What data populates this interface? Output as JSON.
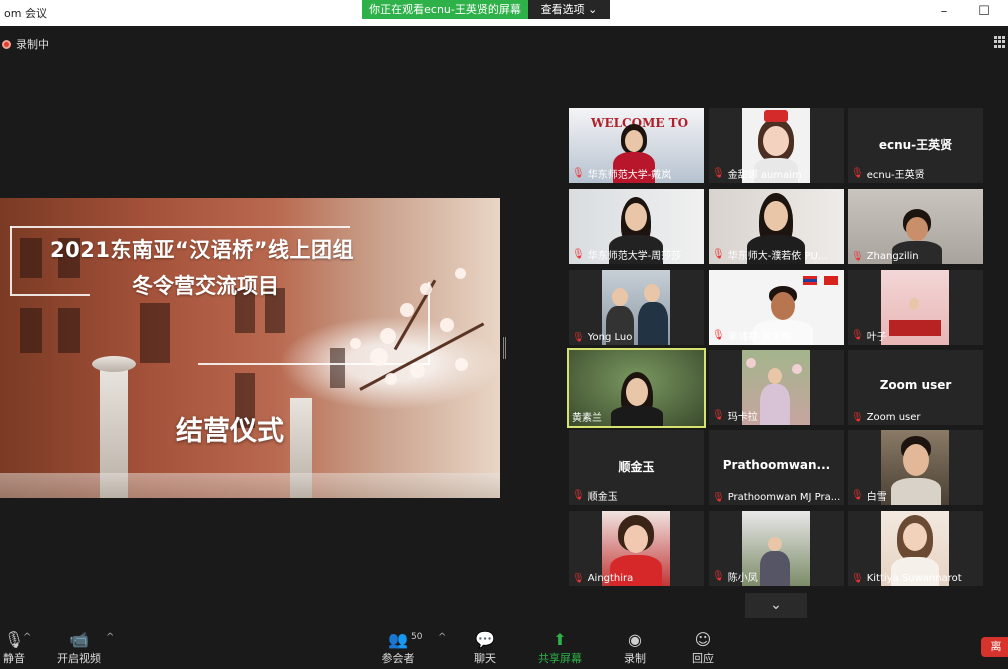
{
  "window": {
    "title": "om 会议"
  },
  "share_banner": {
    "message": "你正在观看ecnu-王英贤的屏幕",
    "options_label": "查看选项 ⌄"
  },
  "recording": {
    "label": "录制中"
  },
  "slide": {
    "title_line1": "2021东南亚“汉语桥”线上团组",
    "title_line2": "冬令营交流项目",
    "subtitle": "结营仪式"
  },
  "gallery": {
    "tiles": [
      {
        "label": "华东师范大学-戴岚",
        "banner": "WELCOME TO"
      },
      {
        "label": "金甜娜 aumaim"
      },
      {
        "label": "ecnu-王英贤",
        "big": "ecnu-王英贤"
      },
      {
        "label": "华东师范大学-周莎莎"
      },
      {
        "label": "华东师大-濮若依 PU..."
      },
      {
        "label": "Zhangzilin"
      },
      {
        "label": "Yong Luo"
      },
      {
        "label": "柬埔寨-黄金辉"
      },
      {
        "label": "叶子"
      },
      {
        "label": "黄素兰"
      },
      {
        "label": "玛卡拉"
      },
      {
        "label": "Zoom user",
        "big": "Zoom user"
      },
      {
        "label": "顺金玉",
        "big": "顺金玉"
      },
      {
        "label": "Prathoomwan MJ Pra...",
        "big": "Prathoomwan..."
      },
      {
        "label": "白雪"
      },
      {
        "label": "Aingthira"
      },
      {
        "label": "陈小凤"
      },
      {
        "label": "Kittiya Suwannarot"
      }
    ],
    "expand_icon": "chevron-down-icon"
  },
  "toolbar": {
    "mute_label": "静音",
    "video_label": "开启视频",
    "participants_label": "参会者",
    "participants_count": "50",
    "chat_label": "聊天",
    "share_label": "共享屏幕",
    "record_label": "录制",
    "reactions_label": "回应",
    "end_label": "离"
  },
  "colors": {
    "accent_green": "#2fb14a",
    "active_speaker": "#d7e36f",
    "end_red": "#d6332c"
  }
}
